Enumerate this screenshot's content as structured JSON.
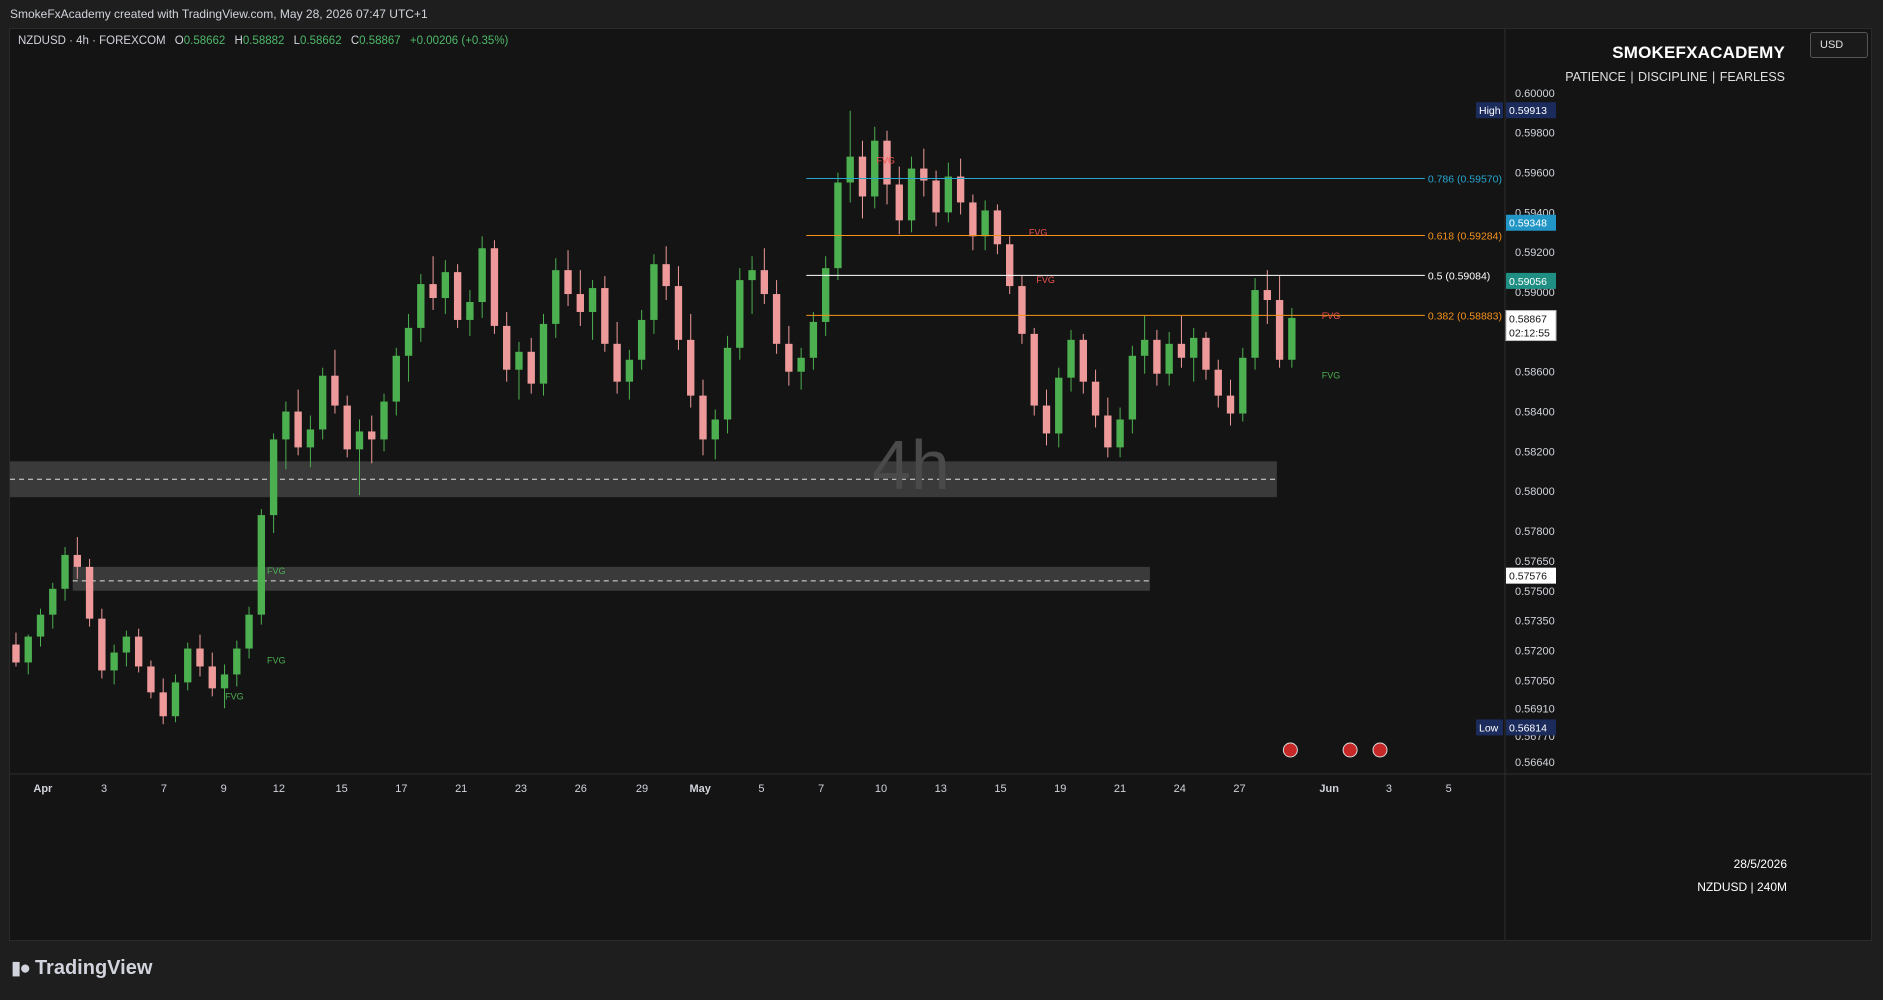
{
  "header": {
    "caption": "SmokeFxAcademy created with TradingView.com, May 28, 2026 07:47 UTC+1"
  },
  "legend": {
    "symbol": "NZDUSD · 4h · FOREXCOM",
    "o_label": "O",
    "o": "0.58662",
    "h_label": "H",
    "h": "0.58882",
    "l_label": "L",
    "l": "0.58662",
    "c_label": "C",
    "c": "0.58867",
    "change": "+0.00206 (+0.35%)"
  },
  "currency_button": "USD",
  "brand": {
    "title": "SMOKEFXACADEMY",
    "subtitle": "PATIENCE  |  DISCIPLINE  |  FEARLESS"
  },
  "watermark": "4h",
  "footer_info": {
    "date": "28/5/2026",
    "pair": "NZDUSD | 240M"
  },
  "footer_logo": "TradingView",
  "colors": {
    "up": "#4caf50",
    "down": "#ef9a9a",
    "accent_blue": "#26a6d1",
    "fib_orange": "#f7931a",
    "high_badge": "#1a2b5c",
    "bg": "#141414"
  },
  "chart_data": {
    "type": "candlestick",
    "symbol": "NZDUSD",
    "timeframe": "4h",
    "ylim": [
      0.5658,
      0.6012
    ],
    "y_ticks": [
      "0.60000",
      "0.59800",
      "0.59600",
      "0.59400",
      "0.59200",
      "0.59000",
      "0.58600",
      "0.58400",
      "0.58200",
      "0.58000",
      "0.57800",
      "0.57650",
      "0.57500",
      "0.57350",
      "0.57200",
      "0.57050",
      "0.56910",
      "0.56770",
      "0.56640"
    ],
    "x_ticks": [
      {
        "label": "Apr",
        "pos": 0.022,
        "bold": true
      },
      {
        "label": "3",
        "pos": 0.063
      },
      {
        "label": "7",
        "pos": 0.103
      },
      {
        "label": "9",
        "pos": 0.143
      },
      {
        "label": "12",
        "pos": 0.18
      },
      {
        "label": "15",
        "pos": 0.222
      },
      {
        "label": "17",
        "pos": 0.262
      },
      {
        "label": "21",
        "pos": 0.302
      },
      {
        "label": "23",
        "pos": 0.342
      },
      {
        "label": "26",
        "pos": 0.382
      },
      {
        "label": "29",
        "pos": 0.423
      },
      {
        "label": "May",
        "pos": 0.462,
        "bold": true
      },
      {
        "label": "5",
        "pos": 0.503
      },
      {
        "label": "7",
        "pos": 0.543
      },
      {
        "label": "10",
        "pos": 0.583
      },
      {
        "label": "13",
        "pos": 0.623
      },
      {
        "label": "15",
        "pos": 0.663
      },
      {
        "label": "19",
        "pos": 0.703
      },
      {
        "label": "21",
        "pos": 0.743
      },
      {
        "label": "24",
        "pos": 0.783
      },
      {
        "label": "27",
        "pos": 0.823
      },
      {
        "label": "Jun",
        "pos": 0.883,
        "bold": true
      },
      {
        "label": "3",
        "pos": 0.923
      },
      {
        "label": "5",
        "pos": 0.963
      }
    ],
    "price_badges": [
      {
        "label": "High",
        "value": "0.59913",
        "price": 0.59913,
        "style": "high"
      },
      {
        "label": "",
        "value": "0.59348",
        "price": 0.59348,
        "style": "blue"
      },
      {
        "label": "",
        "value": "0.59056",
        "price": 0.59056,
        "style": "teal"
      },
      {
        "label": "",
        "value": "0.58867",
        "price": 0.58867,
        "style": "last",
        "sub": "02:12:55"
      },
      {
        "label": "",
        "value": "0.57576",
        "price": 0.57576,
        "style": "white"
      },
      {
        "label": "Low",
        "value": "0.56814",
        "price": 0.56814,
        "style": "low"
      }
    ],
    "fib_levels": [
      {
        "label": "0.786 (0.59570)",
        "price": 0.5957,
        "color": "#26a6d1"
      },
      {
        "label": "0.618 (0.59284)",
        "price": 0.59284,
        "color": "#f7931a"
      },
      {
        "label": "0.5 (0.59084)",
        "price": 0.59084,
        "color": "#ffffff"
      },
      {
        "label": "0.382 (0.58883)",
        "price": 0.58883,
        "color": "#f7931a"
      }
    ],
    "zones": [
      {
        "label": "",
        "type": "gray",
        "x0": 0.0,
        "x1": 0.848,
        "y0": 0.5815,
        "y1": 0.5797,
        "midline": 0.5806
      },
      {
        "label": "",
        "type": "gray",
        "x0": 0.042,
        "x1": 0.763,
        "y0": 0.5762,
        "y1": 0.575,
        "midline": 0.5755
      }
    ],
    "fvg_labels": [
      {
        "label": "FVG",
        "color": "#4caf50",
        "pos": 0.172,
        "price": 0.576
      },
      {
        "label": "FVG",
        "color": "#4caf50",
        "pos": 0.172,
        "price": 0.5715
      },
      {
        "label": "FVG",
        "color": "#4caf50",
        "pos": 0.144,
        "price": 0.5697
      },
      {
        "label": "FVG",
        "color": "#ef5350",
        "pos": 0.58,
        "price": 0.5966
      },
      {
        "label": "FVG",
        "color": "#ef5350",
        "pos": 0.682,
        "price": 0.593
      },
      {
        "label": "FVG",
        "color": "#ef5350",
        "pos": 0.687,
        "price": 0.5906
      },
      {
        "label": "FVG",
        "color": "#ef5350",
        "pos": 0.878,
        "price": 0.5888
      },
      {
        "label": "FVG",
        "color": "#4caf50",
        "pos": 0.878,
        "price": 0.5858
      }
    ],
    "candles": [
      {
        "o": 0.5723,
        "h": 0.5729,
        "l": 0.5712,
        "c": 0.5714
      },
      {
        "o": 0.5714,
        "h": 0.5728,
        "l": 0.5708,
        "c": 0.5727
      },
      {
        "o": 0.5727,
        "h": 0.5741,
        "l": 0.5722,
        "c": 0.5738
      },
      {
        "o": 0.5738,
        "h": 0.5754,
        "l": 0.5731,
        "c": 0.5751
      },
      {
        "o": 0.5751,
        "h": 0.5772,
        "l": 0.5745,
        "c": 0.5768
      },
      {
        "o": 0.5768,
        "h": 0.5777,
        "l": 0.5756,
        "c": 0.5762
      },
      {
        "o": 0.5762,
        "h": 0.5766,
        "l": 0.5732,
        "c": 0.5736
      },
      {
        "o": 0.5736,
        "h": 0.5741,
        "l": 0.5706,
        "c": 0.571
      },
      {
        "o": 0.571,
        "h": 0.5723,
        "l": 0.5703,
        "c": 0.5719
      },
      {
        "o": 0.5719,
        "h": 0.573,
        "l": 0.5712,
        "c": 0.5727
      },
      {
        "o": 0.5727,
        "h": 0.5731,
        "l": 0.5709,
        "c": 0.5712
      },
      {
        "o": 0.5712,
        "h": 0.5715,
        "l": 0.5696,
        "c": 0.5699
      },
      {
        "o": 0.5699,
        "h": 0.5706,
        "l": 0.5683,
        "c": 0.5687
      },
      {
        "o": 0.5687,
        "h": 0.5708,
        "l": 0.5684,
        "c": 0.5704
      },
      {
        "o": 0.5704,
        "h": 0.5724,
        "l": 0.57,
        "c": 0.5721
      },
      {
        "o": 0.5721,
        "h": 0.5728,
        "l": 0.5707,
        "c": 0.5712
      },
      {
        "o": 0.5712,
        "h": 0.5719,
        "l": 0.5697,
        "c": 0.5701
      },
      {
        "o": 0.5701,
        "h": 0.5713,
        "l": 0.5691,
        "c": 0.5708
      },
      {
        "o": 0.5708,
        "h": 0.5725,
        "l": 0.5702,
        "c": 0.5721
      },
      {
        "o": 0.5721,
        "h": 0.5742,
        "l": 0.5716,
        "c": 0.5738
      },
      {
        "o": 0.5738,
        "h": 0.5791,
        "l": 0.5733,
        "c": 0.5788
      },
      {
        "o": 0.5788,
        "h": 0.5829,
        "l": 0.5779,
        "c": 0.5826
      },
      {
        "o": 0.5826,
        "h": 0.5845,
        "l": 0.5811,
        "c": 0.584
      },
      {
        "o": 0.584,
        "h": 0.5851,
        "l": 0.5818,
        "c": 0.5822
      },
      {
        "o": 0.5822,
        "h": 0.5838,
        "l": 0.5812,
        "c": 0.5831
      },
      {
        "o": 0.5831,
        "h": 0.5862,
        "l": 0.5826,
        "c": 0.5858
      },
      {
        "o": 0.5858,
        "h": 0.5871,
        "l": 0.5839,
        "c": 0.5843
      },
      {
        "o": 0.5843,
        "h": 0.5848,
        "l": 0.5817,
        "c": 0.5821
      },
      {
        "o": 0.5821,
        "h": 0.5836,
        "l": 0.5798,
        "c": 0.583
      },
      {
        "o": 0.583,
        "h": 0.5838,
        "l": 0.5814,
        "c": 0.5826
      },
      {
        "o": 0.5826,
        "h": 0.5849,
        "l": 0.582,
        "c": 0.5845
      },
      {
        "o": 0.5845,
        "h": 0.5872,
        "l": 0.5838,
        "c": 0.5868
      },
      {
        "o": 0.5868,
        "h": 0.5889,
        "l": 0.5855,
        "c": 0.5882
      },
      {
        "o": 0.5882,
        "h": 0.5909,
        "l": 0.5875,
        "c": 0.5904
      },
      {
        "o": 0.5904,
        "h": 0.5918,
        "l": 0.5891,
        "c": 0.5897
      },
      {
        "o": 0.5897,
        "h": 0.5916,
        "l": 0.5889,
        "c": 0.591
      },
      {
        "o": 0.591,
        "h": 0.5914,
        "l": 0.5882,
        "c": 0.5886
      },
      {
        "o": 0.5886,
        "h": 0.5901,
        "l": 0.5878,
        "c": 0.5895
      },
      {
        "o": 0.5895,
        "h": 0.5928,
        "l": 0.5887,
        "c": 0.5922
      },
      {
        "o": 0.5922,
        "h": 0.5926,
        "l": 0.5879,
        "c": 0.5883
      },
      {
        "o": 0.5883,
        "h": 0.589,
        "l": 0.5855,
        "c": 0.5861
      },
      {
        "o": 0.5861,
        "h": 0.5875,
        "l": 0.5846,
        "c": 0.587
      },
      {
        "o": 0.587,
        "h": 0.5877,
        "l": 0.5849,
        "c": 0.5854
      },
      {
        "o": 0.5854,
        "h": 0.5889,
        "l": 0.5848,
        "c": 0.5884
      },
      {
        "o": 0.5884,
        "h": 0.5917,
        "l": 0.5877,
        "c": 0.5911
      },
      {
        "o": 0.5911,
        "h": 0.5921,
        "l": 0.5893,
        "c": 0.5899
      },
      {
        "o": 0.5899,
        "h": 0.5911,
        "l": 0.5883,
        "c": 0.589
      },
      {
        "o": 0.589,
        "h": 0.5906,
        "l": 0.5876,
        "c": 0.5902
      },
      {
        "o": 0.5902,
        "h": 0.5908,
        "l": 0.587,
        "c": 0.5874
      },
      {
        "o": 0.5874,
        "h": 0.5885,
        "l": 0.5849,
        "c": 0.5855
      },
      {
        "o": 0.5855,
        "h": 0.5871,
        "l": 0.5846,
        "c": 0.5866
      },
      {
        "o": 0.5866,
        "h": 0.5891,
        "l": 0.5861,
        "c": 0.5886
      },
      {
        "o": 0.5886,
        "h": 0.5919,
        "l": 0.5879,
        "c": 0.5914
      },
      {
        "o": 0.5914,
        "h": 0.5923,
        "l": 0.5896,
        "c": 0.5903
      },
      {
        "o": 0.5903,
        "h": 0.5913,
        "l": 0.5871,
        "c": 0.5876
      },
      {
        "o": 0.5876,
        "h": 0.5889,
        "l": 0.5842,
        "c": 0.5848
      },
      {
        "o": 0.5848,
        "h": 0.5856,
        "l": 0.5818,
        "c": 0.5826
      },
      {
        "o": 0.5826,
        "h": 0.5841,
        "l": 0.5816,
        "c": 0.5836
      },
      {
        "o": 0.5836,
        "h": 0.5878,
        "l": 0.5829,
        "c": 0.5872
      },
      {
        "o": 0.5872,
        "h": 0.5912,
        "l": 0.5866,
        "c": 0.5906
      },
      {
        "o": 0.5906,
        "h": 0.5918,
        "l": 0.5889,
        "c": 0.5911
      },
      {
        "o": 0.5911,
        "h": 0.5922,
        "l": 0.5894,
        "c": 0.5899
      },
      {
        "o": 0.5899,
        "h": 0.5906,
        "l": 0.5869,
        "c": 0.5874
      },
      {
        "o": 0.5874,
        "h": 0.5883,
        "l": 0.5853,
        "c": 0.586
      },
      {
        "o": 0.586,
        "h": 0.5872,
        "l": 0.5851,
        "c": 0.5867
      },
      {
        "o": 0.5867,
        "h": 0.589,
        "l": 0.5861,
        "c": 0.5885
      },
      {
        "o": 0.5885,
        "h": 0.5918,
        "l": 0.5878,
        "c": 0.5912
      },
      {
        "o": 0.5912,
        "h": 0.596,
        "l": 0.5906,
        "c": 0.5955
      },
      {
        "o": 0.5955,
        "h": 0.5991,
        "l": 0.5945,
        "c": 0.5968
      },
      {
        "o": 0.5968,
        "h": 0.5976,
        "l": 0.5937,
        "c": 0.5948
      },
      {
        "o": 0.5948,
        "h": 0.5983,
        "l": 0.5942,
        "c": 0.5976
      },
      {
        "o": 0.5976,
        "h": 0.5981,
        "l": 0.5944,
        "c": 0.5954
      },
      {
        "o": 0.5954,
        "h": 0.5963,
        "l": 0.5929,
        "c": 0.5936
      },
      {
        "o": 0.5936,
        "h": 0.5968,
        "l": 0.593,
        "c": 0.5962
      },
      {
        "o": 0.5962,
        "h": 0.5972,
        "l": 0.5948,
        "c": 0.5956
      },
      {
        "o": 0.5956,
        "h": 0.5961,
        "l": 0.5933,
        "c": 0.594
      },
      {
        "o": 0.594,
        "h": 0.5965,
        "l": 0.5935,
        "c": 0.5958
      },
      {
        "o": 0.5958,
        "h": 0.5967,
        "l": 0.5939,
        "c": 0.5945
      },
      {
        "o": 0.5945,
        "h": 0.5949,
        "l": 0.5921,
        "c": 0.5928
      },
      {
        "o": 0.5928,
        "h": 0.5946,
        "l": 0.5921,
        "c": 0.5941
      },
      {
        "o": 0.5941,
        "h": 0.5944,
        "l": 0.5919,
        "c": 0.5924
      },
      {
        "o": 0.5924,
        "h": 0.5928,
        "l": 0.5899,
        "c": 0.5903
      },
      {
        "o": 0.5903,
        "h": 0.5908,
        "l": 0.5874,
        "c": 0.5879
      },
      {
        "o": 0.5879,
        "h": 0.5882,
        "l": 0.5838,
        "c": 0.5843
      },
      {
        "o": 0.5843,
        "h": 0.5851,
        "l": 0.5823,
        "c": 0.5829
      },
      {
        "o": 0.5829,
        "h": 0.5862,
        "l": 0.5822,
        "c": 0.5857
      },
      {
        "o": 0.5857,
        "h": 0.5881,
        "l": 0.585,
        "c": 0.5876
      },
      {
        "o": 0.5876,
        "h": 0.5879,
        "l": 0.5849,
        "c": 0.5855
      },
      {
        "o": 0.5855,
        "h": 0.5861,
        "l": 0.5832,
        "c": 0.5838
      },
      {
        "o": 0.5838,
        "h": 0.5847,
        "l": 0.5817,
        "c": 0.5822
      },
      {
        "o": 0.5822,
        "h": 0.5842,
        "l": 0.5817,
        "c": 0.5836
      },
      {
        "o": 0.5836,
        "h": 0.5873,
        "l": 0.5829,
        "c": 0.5868
      },
      {
        "o": 0.5868,
        "h": 0.5888,
        "l": 0.5859,
        "c": 0.5876
      },
      {
        "o": 0.5876,
        "h": 0.5881,
        "l": 0.5853,
        "c": 0.5859
      },
      {
        "o": 0.5859,
        "h": 0.588,
        "l": 0.5853,
        "c": 0.5874
      },
      {
        "o": 0.5874,
        "h": 0.5888,
        "l": 0.5862,
        "c": 0.5867
      },
      {
        "o": 0.5867,
        "h": 0.5882,
        "l": 0.5855,
        "c": 0.5877
      },
      {
        "o": 0.5877,
        "h": 0.588,
        "l": 0.5856,
        "c": 0.5861
      },
      {
        "o": 0.5861,
        "h": 0.5866,
        "l": 0.5842,
        "c": 0.5848
      },
      {
        "o": 0.5848,
        "h": 0.5856,
        "l": 0.5833,
        "c": 0.5839
      },
      {
        "o": 0.5839,
        "h": 0.5872,
        "l": 0.5835,
        "c": 0.5867
      },
      {
        "o": 0.5867,
        "h": 0.5907,
        "l": 0.5861,
        "c": 0.5901
      },
      {
        "o": 0.5901,
        "h": 0.5911,
        "l": 0.5884,
        "c": 0.5896
      },
      {
        "o": 0.5896,
        "h": 0.5908,
        "l": 0.5862,
        "c": 0.5866
      },
      {
        "o": 0.5866,
        "h": 0.5892,
        "l": 0.5862,
        "c": 0.5887
      }
    ]
  }
}
